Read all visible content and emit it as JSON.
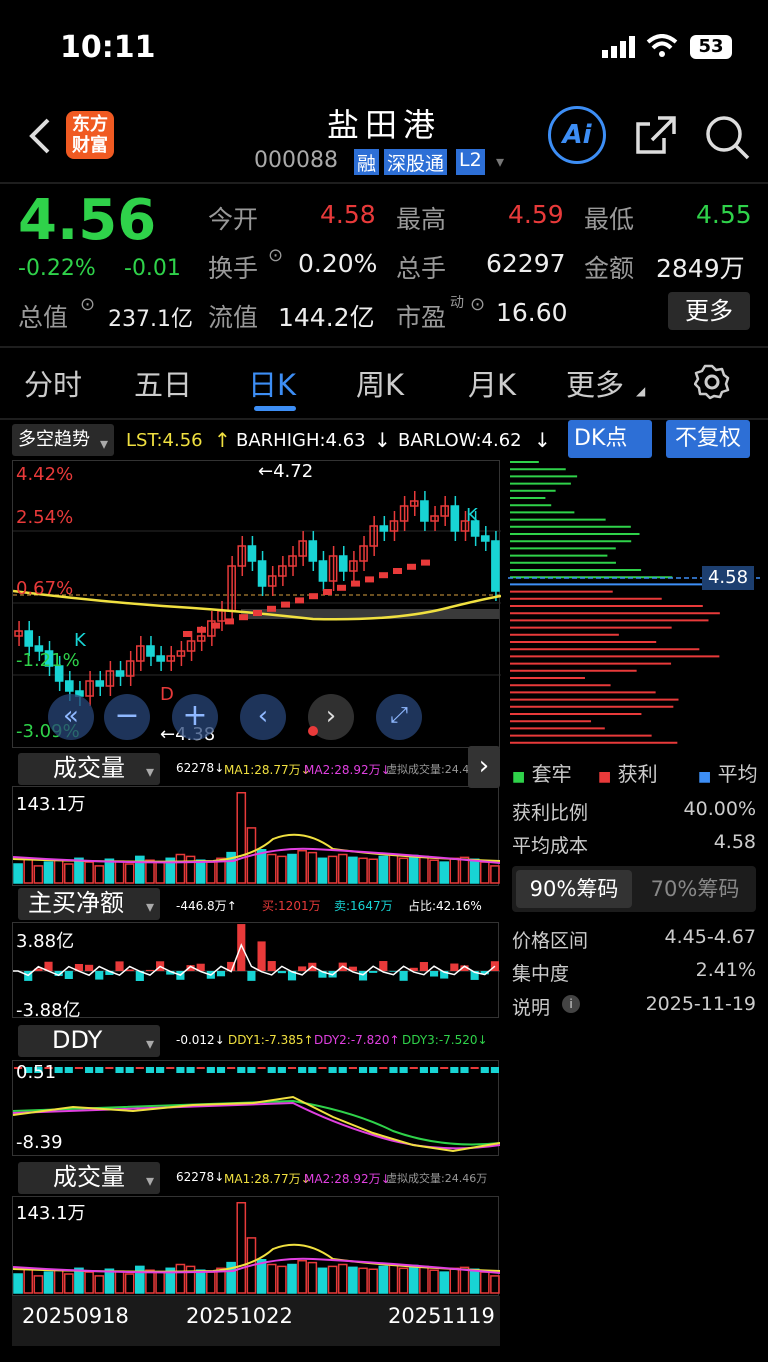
{
  "status": {
    "time": "10:11",
    "battery": "53"
  },
  "header": {
    "title": "盐田港",
    "code": "000088",
    "tags": [
      "融",
      "深股通",
      "L2"
    ],
    "logo": "东方财富",
    "ai_label": "Ai"
  },
  "quote": {
    "price": "4.56",
    "pct": "-0.22%",
    "chg": "-0.01",
    "total_cap_label": "总值",
    "total_cap": "237.1亿",
    "open_label": "今开",
    "open": "4.58",
    "high_label": "最高",
    "high": "4.59",
    "low_label": "最低",
    "low": "4.55",
    "turnover_label": "换手",
    "turnover": "0.20%",
    "volume_label": "总手",
    "volume": "62297",
    "amount_label": "金额",
    "amount": "2849万",
    "float_label": "流值",
    "float_cap": "144.2亿",
    "pe_label": "市盈",
    "pe_sup": "动",
    "pe": "16.60",
    "more": "更多"
  },
  "tabs": [
    "分时",
    "五日",
    "日K",
    "周K",
    "月K",
    "更多"
  ],
  "indicator_bar": {
    "select": "多空趋势",
    "lst": "LST:4.56",
    "barhigh": "BARHIGH:4.63",
    "barlow": "BARLOW:4.62",
    "dk": "DK点",
    "adjust": "不复权"
  },
  "kchart": {
    "y_labels": [
      "4.42%",
      "2.54%",
      "0.67%",
      "-1.21%",
      "-3.09%"
    ],
    "max_label": "4.72",
    "min_label": "4.38",
    "k1": "K",
    "k2": "K",
    "d": "D",
    "price_tag": "4.58",
    "colors": {
      "up": "#e83a3a",
      "down": "#18d4d4",
      "ma": "#f0e040"
    }
  },
  "vol_panel": {
    "select": "成交量",
    "v": "62278",
    "ma1": "MA1:28.77万",
    "ma2": "MA2:28.92万",
    "virt": "虚拟成交量:24.46万",
    "ymax": "143.1万"
  },
  "net_panel": {
    "select": "主买净额",
    "v": "-446.8万",
    "buy": "买:1201万",
    "sell": "卖:1647万",
    "ratio": "占比:42.16%",
    "ymax": "3.88亿",
    "ymin": "-3.88亿"
  },
  "ddy_panel": {
    "select": "DDY",
    "v": "-0.012",
    "d1": "DDY1:-7.385",
    "d2": "DDY2:-7.820",
    "d3": "DDY3:-7.520",
    "ymax": "0.51",
    "ymin": "-8.39"
  },
  "vol2_panel": {
    "select": "成交量",
    "v": "62278",
    "ma1": "MA1:28.77万",
    "ma2": "MA2:28.92万",
    "virt": "虚拟成交量:24.46万",
    "ymax": "143.1万"
  },
  "dates": [
    "20250918",
    "20251022",
    "20251119"
  ],
  "chips": {
    "legend": [
      "套牢",
      "获利",
      "平均"
    ],
    "profit_ratio_label": "获利比例",
    "profit_ratio": "40.00%",
    "avg_cost_label": "平均成本",
    "avg_cost": "4.58",
    "tab90": "90%筹码",
    "tab70": "70%筹码",
    "range_label": "价格区间",
    "range": "4.45-4.67",
    "conc_label": "集中度",
    "conc": "2.41%",
    "note_label": "说明",
    "note": "2025-11-19"
  }
}
